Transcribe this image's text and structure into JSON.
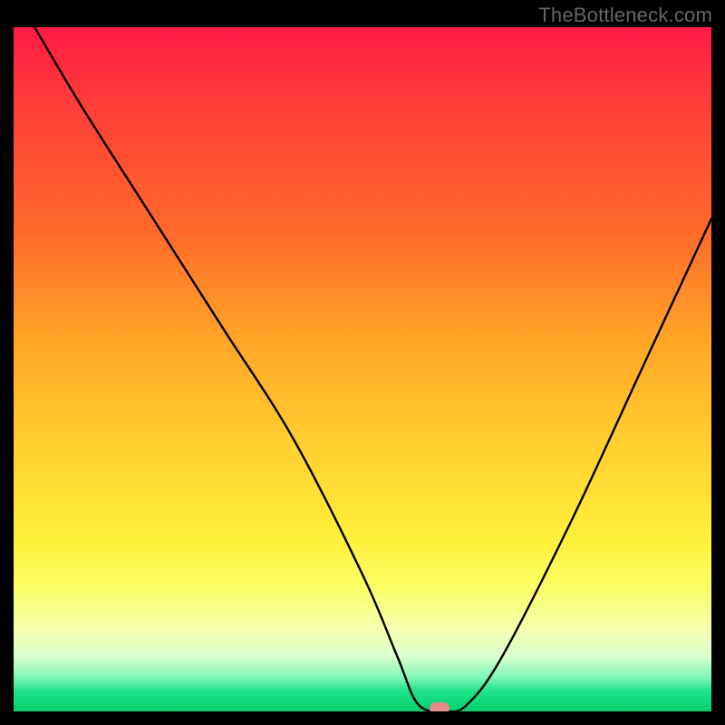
{
  "watermark": "TheBottleneck.com",
  "chart_data": {
    "type": "line",
    "title": "",
    "xlabel": "",
    "ylabel": "",
    "xlim": [
      0,
      100
    ],
    "ylim": [
      0,
      100
    ],
    "series": [
      {
        "name": "bottleneck-curve",
        "x": [
          3,
          10,
          20,
          30,
          40,
          50,
          55,
          58,
          62,
          65,
          70,
          80,
          90,
          100
        ],
        "y": [
          100,
          88,
          72,
          56,
          40,
          20,
          8,
          1,
          0,
          1,
          8,
          28,
          50,
          72
        ]
      }
    ],
    "marker": {
      "x": 61,
      "y": 0
    },
    "gradient_note": "vertical red→orange→yellow→green heat gradient"
  }
}
